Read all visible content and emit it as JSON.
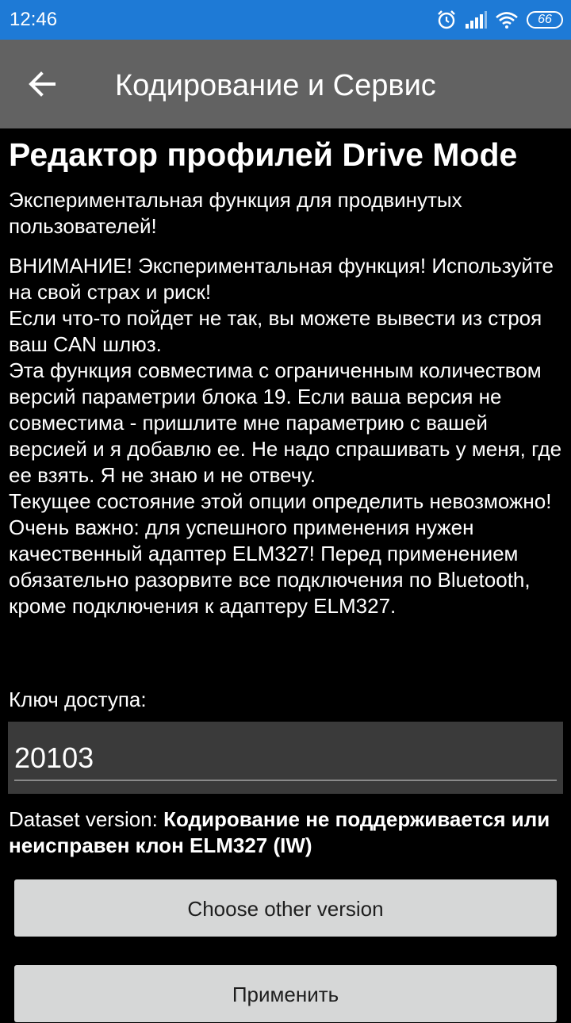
{
  "status_bar": {
    "time": "12:46",
    "battery": "66",
    "icons": [
      "alarm-icon",
      "signal-icon",
      "wifi-icon",
      "battery-icon"
    ]
  },
  "app_bar": {
    "back_icon": "arrow-left-icon",
    "title": "Кодирование и Сервис"
  },
  "page": {
    "heading": "Редактор профилей Drive Mode",
    "subtitle": "Экспериментальная функция для продвинутых пользователей!",
    "warning_lines": [
      "ВНИМАНИЕ! Экспериментальная функция! Используйте на свой страх и риск!",
      "Если что-то пойдет не так, вы можете вывести из строя ваш CAN шлюз.",
      "Эта функция совместима с ограниченным количеством версий параметрии блока 19. Если ваша версия не совместима - пришлите мне параметрию с вашей версией и я добавлю ее. Не надо спрашивать у меня, где ее взять. Я не знаю и не отвечу.",
      "Текущее состояние этой опции определить невозможно!",
      "Очень важно: для успешного применения нужен качественный адаптер ELM327! Перед применением обязательно разорвите все подключения по Bluetooth, кроме подключения к адаптеру ELM327."
    ],
    "key_label": "Ключ доступа:",
    "key_value": "20103",
    "dataset_label": "Dataset version: ",
    "dataset_value": "Кодирование не поддерживается или неисправен клон ELM327 (IW)",
    "choose_button": "Choose other version",
    "apply_button": "Применить"
  },
  "colors": {
    "status_bar": "#1e7ad6",
    "app_bar": "#626262",
    "background": "#000000",
    "input_background": "#3a3a3a",
    "button_background": "#d6d7d7"
  }
}
